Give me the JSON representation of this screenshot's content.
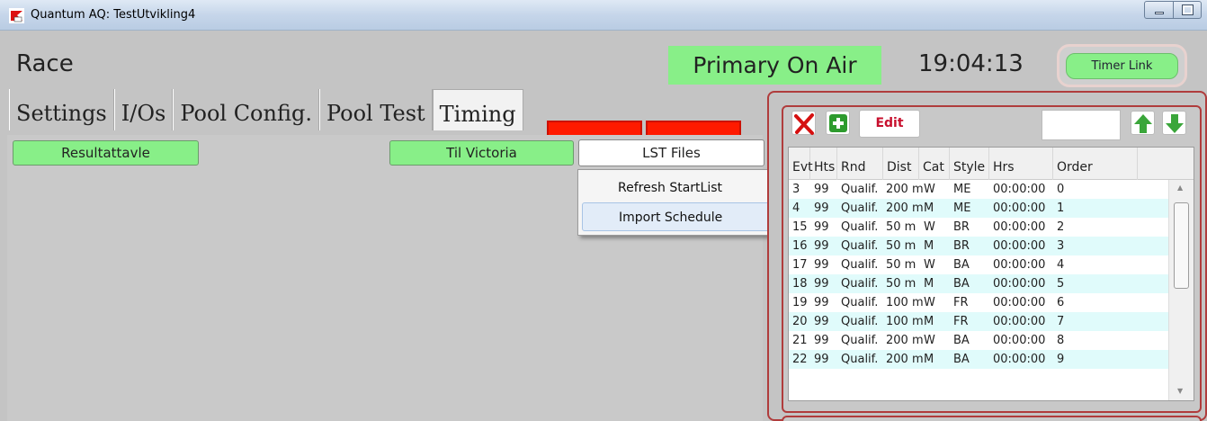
{
  "window": {
    "title": "Quantum AQ: TestUtvikling4"
  },
  "header": {
    "race_label": "Race",
    "status": "Primary On Air",
    "clock": "19:04:13",
    "timer_link": "Timer Link"
  },
  "tabs": [
    {
      "label": "Settings"
    },
    {
      "label": "I/Os"
    },
    {
      "label": "Pool Config."
    },
    {
      "label": "Pool Test"
    },
    {
      "label": "Timing"
    }
  ],
  "tab_active": "Timing",
  "content": {
    "resultattavle": "Resultattavle",
    "til_victoria": "Til Victoria",
    "lst_files": "LST Files"
  },
  "menu": {
    "items": [
      {
        "label": "Refresh StartList"
      },
      {
        "label": "Import Schedule"
      }
    ]
  },
  "schedule": {
    "edit_label": "Edit",
    "search_value": "",
    "columns": [
      "Evt",
      "Hts",
      "Rnd",
      "Dist",
      "Cat",
      "Style",
      "Hrs",
      "Order"
    ],
    "rows": [
      [
        "3",
        "99",
        "Qualif.",
        "200 m",
        "W",
        "ME",
        "00:00:00",
        "0"
      ],
      [
        "4",
        "99",
        "Qualif.",
        "200 m",
        "M",
        "ME",
        "00:00:00",
        "1"
      ],
      [
        "15",
        "99",
        "Qualif.",
        "50 m",
        "W",
        "BR",
        "00:00:00",
        "2"
      ],
      [
        "16",
        "99",
        "Qualif.",
        "50 m",
        "M",
        "BR",
        "00:00:00",
        "3"
      ],
      [
        "17",
        "99",
        "Qualif.",
        "50 m",
        "W",
        "BA",
        "00:00:00",
        "4"
      ],
      [
        "18",
        "99",
        "Qualif.",
        "50 m",
        "M",
        "BA",
        "00:00:00",
        "5"
      ],
      [
        "19",
        "99",
        "Qualif.",
        "100 m",
        "W",
        "FR",
        "00:00:00",
        "6"
      ],
      [
        "20",
        "99",
        "Qualif.",
        "100 m",
        "M",
        "FR",
        "00:00:00",
        "7"
      ],
      [
        "21",
        "99",
        "Qualif.",
        "200 m",
        "W",
        "BA",
        "00:00:00",
        "8"
      ],
      [
        "22",
        "99",
        "Qualif.",
        "200 m",
        "M",
        "BA",
        "00:00:00",
        "9"
      ]
    ]
  },
  "colors": {
    "green_button": "#88ef88",
    "red_tab": "#ff1a00",
    "panel_border": "#b03c3c",
    "row_alt": "#e0fbfb"
  },
  "icons": {
    "app": "quantum-app-icon",
    "delete": "red-x-icon",
    "add": "green-plus-icon",
    "up": "green-up-arrow-icon",
    "down": "green-down-arrow-icon"
  }
}
